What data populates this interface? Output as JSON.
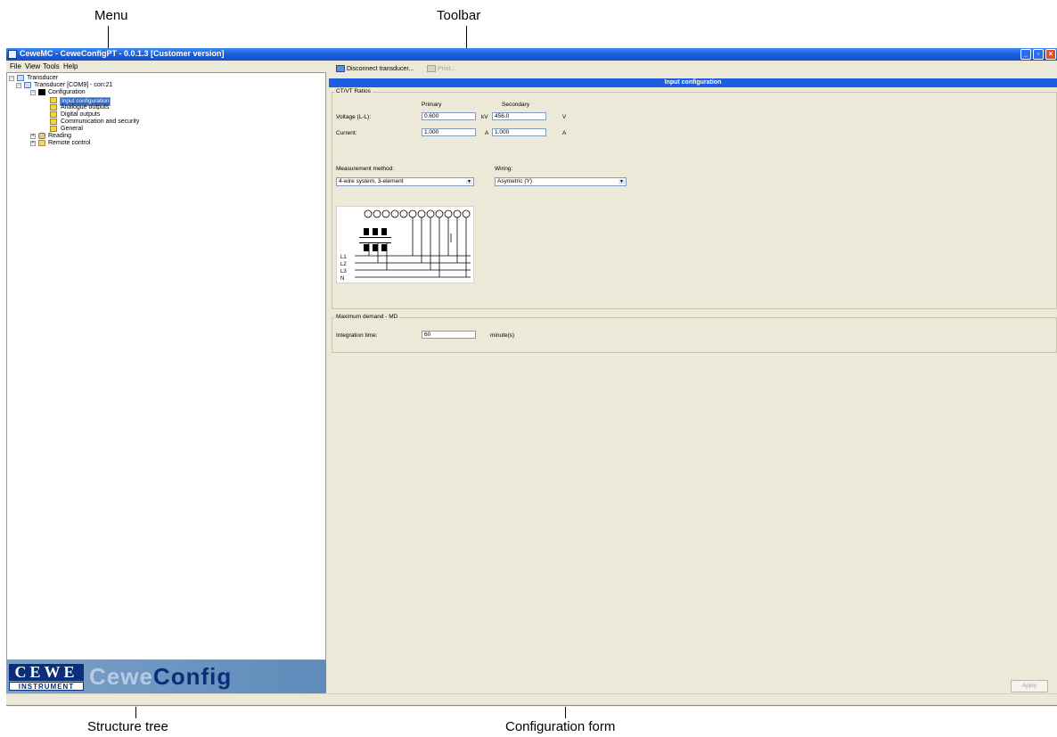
{
  "callouts": {
    "menu": "Menu",
    "toolbar": "Toolbar",
    "structure_tree": "Structure tree",
    "configuration_form": "Configuration form"
  },
  "window": {
    "title": "CeweMC - CeweConfigPT - 0.0.1.3 [Customer version]"
  },
  "menu": {
    "items": [
      "File",
      "View",
      "Tools",
      "Help"
    ]
  },
  "toolbar": {
    "disconnect_label": "Disconnect transducer...",
    "print_label": "Print..."
  },
  "tree": {
    "root": "Transducer",
    "device": "Transducer [COM9] - con:21",
    "configuration": "Configuration",
    "children": [
      "Input configuration",
      "Analogue outputs",
      "Digital outputs",
      "Communication and security",
      "General"
    ],
    "reading": "Reading",
    "remote_control": "Remote control",
    "selected": "Input configuration"
  },
  "logo": {
    "brand": "CEWE",
    "subline": "INSTRUMENT",
    "product_pale": "Cewe",
    "product_bold": "Config"
  },
  "panel": {
    "title": "Input configuration"
  },
  "ratios": {
    "group_title": "CT/VT Ratios",
    "primary_header": "Primary",
    "secondary_header": "Secondary",
    "voltage_label": "Voltage (L-L):",
    "voltage_primary": "0.600",
    "voltage_primary_unit": "kV",
    "voltage_secondary": "456.0",
    "voltage_secondary_unit": "V",
    "current_label": "Current:",
    "current_primary": "1.000",
    "current_primary_unit": "A",
    "current_secondary": "1.000",
    "current_secondary_unit": "A"
  },
  "measurement": {
    "method_label": "Measurement method:",
    "method_value": "4-wire system, 3-element",
    "wiring_label": "Wiring:",
    "wiring_value": "Asymetric (Y)"
  },
  "diagram": {
    "lines": [
      "L1",
      "L2",
      "L3",
      "N"
    ]
  },
  "demand": {
    "group_title": "Maximum demand - MD",
    "integration_label": "Integration time:",
    "integration_value": "60",
    "integration_unit": "minute(s)"
  },
  "apply_label": "Apply"
}
